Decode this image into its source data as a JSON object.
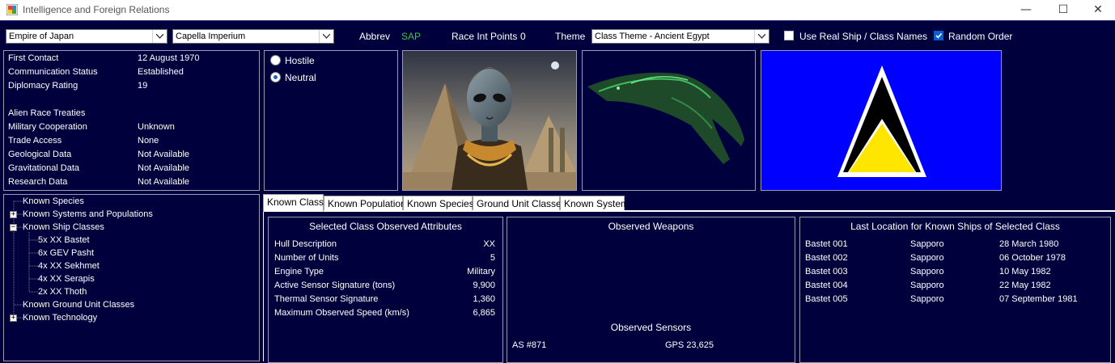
{
  "window": {
    "title": "Intelligence and Foreign Relations",
    "controls": {
      "minimize": "—",
      "maximize": "☐",
      "close": "✕"
    }
  },
  "toolbar": {
    "empire": "Empire of Japan",
    "alien_race": "Capella Imperium",
    "abbrev_label": "Abbrev",
    "abbrev_value": "SAP",
    "race_int_label": "Race Int Points",
    "race_int_value": "0",
    "theme_label": "Theme",
    "theme_value": "Class Theme - Ancient Egypt",
    "use_real_names_label": "Use Real Ship / Class Names",
    "use_real_names_checked": false,
    "random_order_label": "Random Order",
    "random_order_checked": true
  },
  "info": {
    "rows": [
      {
        "label": "First Contact",
        "value": "12 August 1970"
      },
      {
        "label": "Communication Status",
        "value": "Established"
      },
      {
        "label": "Diplomacy Rating",
        "value": "19"
      }
    ],
    "treaties_title": "Alien Race Treaties",
    "treaties": [
      {
        "label": "Military Cooperation",
        "value": "Unknown"
      },
      {
        "label": "Trade Access",
        "value": "None"
      },
      {
        "label": "Geological Data",
        "value": "Not Available"
      },
      {
        "label": "Gravitational Data",
        "value": "Not Available"
      },
      {
        "label": "Research Data",
        "value": "Not Available"
      }
    ]
  },
  "stance": {
    "hostile_label": "Hostile",
    "neutral_label": "Neutral",
    "selected": "Neutral"
  },
  "flag": {
    "background": "#0000ff",
    "triangle_outer": "#ffffff",
    "triangle_mid": "#000000",
    "triangle_inner": "#ffe600"
  },
  "tree": {
    "known_species": "Known Species",
    "known_systems": "Known Systems and Populations",
    "known_ship_classes": "Known Ship Classes",
    "classes": [
      "5x XX Bastet",
      "6x GEV Pasht",
      "4x XX Sekhmet",
      "4x XX Serapis",
      "2x XX Thoth"
    ],
    "known_ground_units": "Known Ground Unit Classes",
    "known_technology": "Known Technology"
  },
  "tabs": [
    "Known Class",
    "Known Population",
    "Known Species",
    "Ground Unit Classes",
    "Known System"
  ],
  "class_attributes": {
    "title": "Selected Class Observed Attributes",
    "rows": [
      {
        "label": "Hull Description",
        "value": "XX"
      },
      {
        "label": "Number of Units",
        "value": "5"
      },
      {
        "label": "Engine Type",
        "value": "Military"
      },
      {
        "label": "Active Sensor Signature (tons)",
        "value": "9,900"
      },
      {
        "label": "Thermal Sensor Signature",
        "value": "1,360"
      },
      {
        "label": "Maximum Observed Speed (km/s)",
        "value": "6,865"
      }
    ]
  },
  "weapons": {
    "title": "Observed Weapons",
    "sensors_title": "Observed Sensors",
    "sensors": [
      "AS #871",
      "GPS 23,625"
    ]
  },
  "last_location": {
    "title": "Last Location for Known Ships of Selected Class",
    "rows": [
      {
        "ship": "Bastet 001",
        "location": "Sapporo",
        "date": "28 March 1980"
      },
      {
        "ship": "Bastet 002",
        "location": "Sapporo",
        "date": "06 October 1978"
      },
      {
        "ship": "Bastet 003",
        "location": "Sapporo",
        "date": "10 May 1982"
      },
      {
        "ship": "Bastet 004",
        "location": "Sapporo",
        "date": "22 May 1982"
      },
      {
        "ship": "Bastet 005",
        "location": "Sapporo",
        "date": "07 September 1981"
      }
    ]
  }
}
